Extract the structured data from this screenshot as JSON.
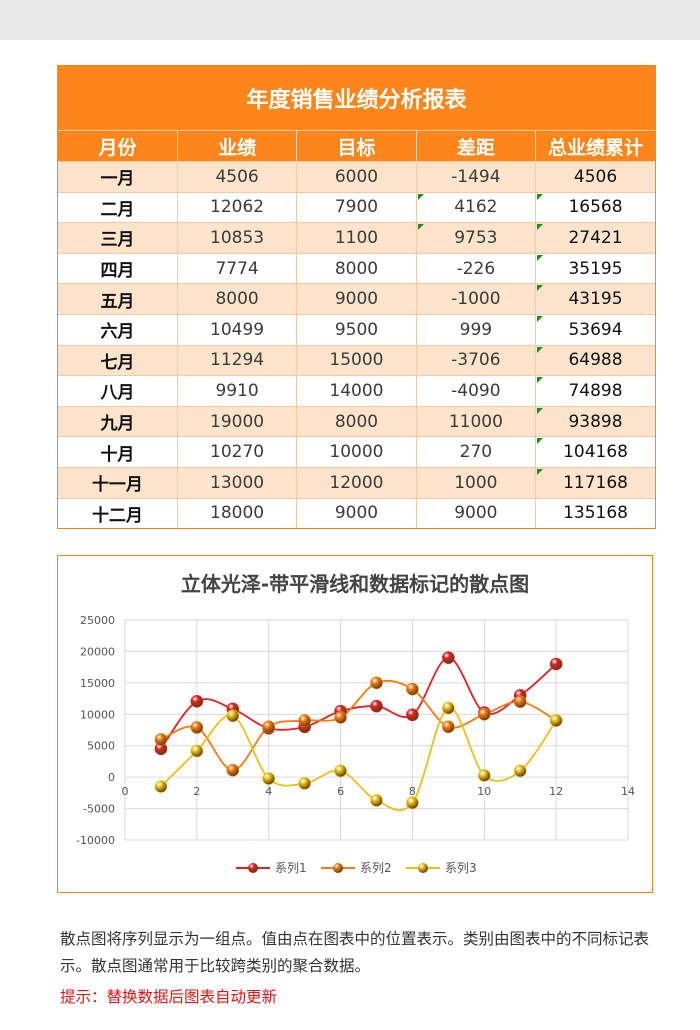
{
  "report": {
    "title": "年度销售业绩分析报表",
    "headers": [
      "月份",
      "业绩",
      "目标",
      "差距",
      "总业绩累计"
    ],
    "rows": [
      [
        "一月",
        "4506",
        "6000",
        "-1494",
        "4506"
      ],
      [
        "二月",
        "12062",
        "7900",
        "4162",
        "16568"
      ],
      [
        "三月",
        "10853",
        "1100",
        "9753",
        "27421"
      ],
      [
        "四月",
        "7774",
        "8000",
        "-226",
        "35195"
      ],
      [
        "五月",
        "8000",
        "9000",
        "-1000",
        "43195"
      ],
      [
        "六月",
        "10499",
        "9500",
        "999",
        "53694"
      ],
      [
        "七月",
        "11294",
        "15000",
        "-3706",
        "64988"
      ],
      [
        "八月",
        "9910",
        "14000",
        "-4090",
        "74898"
      ],
      [
        "九月",
        "19000",
        "8000",
        "11000",
        "93898"
      ],
      [
        "十月",
        "10270",
        "10000",
        "270",
        "104168"
      ],
      [
        "十一月",
        "13000",
        "12000",
        "1000",
        "117168"
      ],
      [
        "十二月",
        "18000",
        "9000",
        "9000",
        "135168"
      ]
    ],
    "colors": {
      "header": "#fd8519",
      "band": "#fde4cb",
      "flag": "#1c8c1c"
    }
  },
  "chart_data": {
    "type": "scatter",
    "title": "立体光泽-带平滑线和数据标记的散点图",
    "xlabel": "",
    "ylabel": "",
    "xlim": [
      0,
      14
    ],
    "ylim": [
      -10000,
      25000
    ],
    "xticks": [
      "0",
      "2",
      "4",
      "6",
      "8",
      "10",
      "12",
      "14"
    ],
    "yticks": [
      "25000",
      "20000",
      "15000",
      "10000",
      "5000",
      "0",
      "-5000",
      "-10000"
    ],
    "grid": true,
    "legend": "bottom",
    "x": [
      1,
      2,
      3,
      4,
      5,
      6,
      7,
      8,
      9,
      10,
      11,
      12
    ],
    "series": [
      {
        "name": "系列1",
        "color": "#d9242a",
        "values": [
          4506,
          12062,
          10853,
          7774,
          8000,
          10499,
          11294,
          9910,
          19000,
          10270,
          13000,
          18000
        ]
      },
      {
        "name": "系列2",
        "color": "#ef7d14",
        "values": [
          6000,
          7900,
          1100,
          8000,
          9000,
          9500,
          15000,
          14000,
          8000,
          10000,
          12000,
          9000
        ]
      },
      {
        "name": "系列3",
        "color": "#e6c21d",
        "values": [
          -1494,
          4162,
          9753,
          -226,
          -1000,
          999,
          -3706,
          -4090,
          11000,
          270,
          1000,
          9000
        ]
      }
    ]
  },
  "description": "散点图将序列显示为一组点。值由点在图表中的位置表示。类别由图表中的不同标记表示。散点图通常用于比较跨类别的聚合数据。",
  "tip": "提示：替换数据后图表自动更新"
}
